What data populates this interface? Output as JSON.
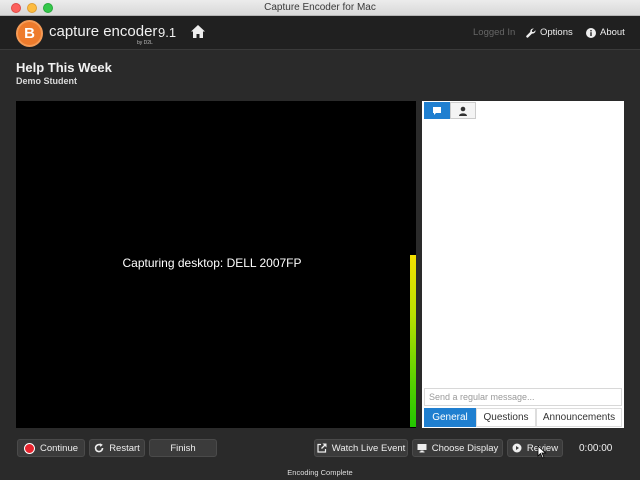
{
  "window": {
    "title": "Capture Encoder for Mac"
  },
  "header": {
    "logo_letter": "B",
    "app_name": "capture encoder",
    "by_label": "by D2L",
    "version": "9.1",
    "logged_in_label": "Logged In",
    "options_label": "Options",
    "about_label": "About"
  },
  "page": {
    "title": "Help This Week",
    "subtitle": "Demo Student"
  },
  "preview": {
    "capture_text": "Capturing desktop: DELL 2007FP"
  },
  "chat": {
    "input_placeholder": "Send a regular message...",
    "categories": [
      "General",
      "Questions",
      "Announcements"
    ],
    "active_category": "General"
  },
  "controls": {
    "continue_label": "Continue",
    "restart_label": "Restart",
    "finish_label": "Finish",
    "watch_label": "Watch Live Event",
    "display_label": "Choose Display",
    "review_label": "Review",
    "timer": "0:00:00"
  },
  "status": {
    "text": "Encoding Complete"
  },
  "colors": {
    "accent_blue": "#1f7fd0",
    "brand_orange": "#ee7b2c",
    "record_red": "#e8242e"
  }
}
